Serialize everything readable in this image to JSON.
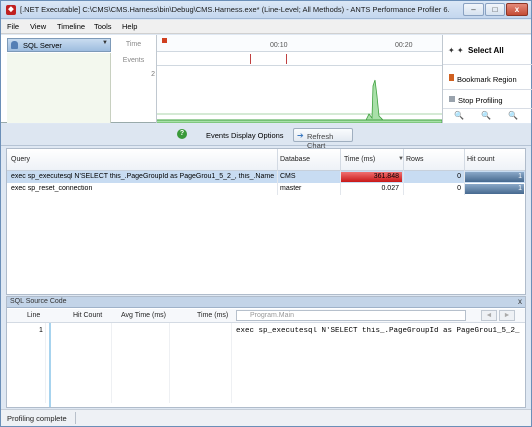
{
  "window": {
    "title": "[.NET Executable] C:\\CMS\\CMS.Harness\\bin\\Debug\\CMS.Harness.exe* (Line-Level; All Methods) - ANTS Performance Profiler 6.0.0.13...",
    "app_icon": "ants-profiler-icon",
    "min": "‒",
    "max": "□",
    "close": "x"
  },
  "menu": {
    "file": "File",
    "view": "View",
    "timeline": "Timeline",
    "tools": "Tools",
    "help": "Help"
  },
  "timeline": {
    "selector_label": "SQL Server",
    "time_label": "Time",
    "events_label": "Events",
    "axis_value": "2",
    "tick_1": "00:10",
    "tick_2": "00:20",
    "select_all": "Select All",
    "select_all_arrows": "✦ ✦",
    "bookmark_region": "Bookmark Region",
    "stop_profiling": "Stop Profiling",
    "zoom_in": "🔍",
    "zoom_out": "🔍",
    "zoom_fit": "🔍"
  },
  "midbar": {
    "help": "?",
    "events_display_options": "Events Display Options",
    "refresh_chart": "Refresh Chart",
    "refresh_icon": "➔"
  },
  "results": {
    "columns": {
      "query": "Query",
      "database": "Database",
      "time": "Time (ms)",
      "sort": "▼",
      "rows": "Rows",
      "hit_count": "Hit count"
    },
    "rows": [
      {
        "query": "exec sp_executesql N'SELECT this_.PageGroupId as PageGrou1_5_2_, this_.Name as ...",
        "database": "CMS",
        "time": "361.848",
        "time_fraction": 1.0,
        "rows": "0",
        "hit_count": "1",
        "hit_fraction": 1.0
      },
      {
        "query": "exec sp_reset_connection",
        "database": "master",
        "time": "0.027",
        "time_fraction": 0.0,
        "rows": "0",
        "hit_count": "1",
        "hit_fraction": 1.0
      }
    ]
  },
  "source": {
    "title": "SQL Source Code",
    "close": "x",
    "columns": {
      "line": "Line",
      "hit_count": "Hit Count",
      "avg_time": "Avg Time (ms)",
      "time": "Time (ms)"
    },
    "method_combo": "Program.Main",
    "nav_back": "◄",
    "nav_forward": "►",
    "line_number": "1",
    "code": "exec sp_executesql N'SELECT this_.PageGroupId as PageGrou1_5_2_"
  },
  "status": {
    "text": "Profiling complete"
  }
}
